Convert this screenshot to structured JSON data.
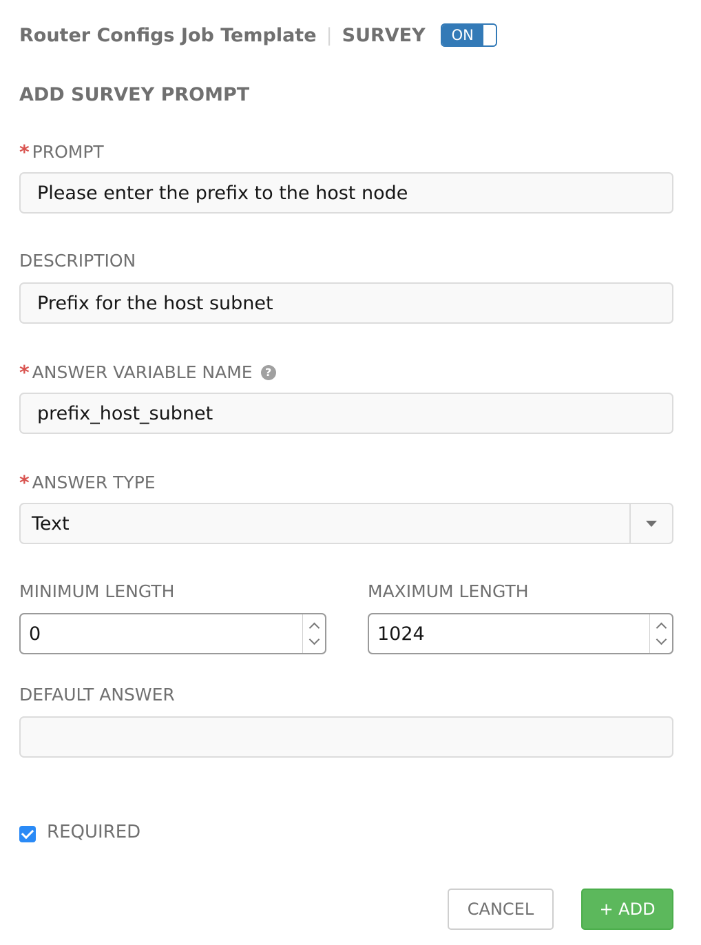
{
  "header": {
    "template_name": "Router Configs Job Template",
    "separator": "|",
    "survey_label": "SURVEY",
    "toggle_label": "ON"
  },
  "section_title": "ADD SURVEY PROMPT",
  "prompt": {
    "label": "PROMPT",
    "required_marker": "*",
    "value": "Please enter the prefix to the host node"
  },
  "description": {
    "label": "DESCRIPTION",
    "value": "Prefix for the host subnet"
  },
  "answer_variable": {
    "label": "ANSWER VARIABLE NAME",
    "required_marker": "*",
    "help_icon": "question-circle-icon",
    "help_glyph": "?",
    "value": "prefix_host_subnet"
  },
  "answer_type": {
    "label": "ANSWER TYPE",
    "required_marker": "*",
    "value": "Text"
  },
  "min_length": {
    "label": "MINIMUM LENGTH",
    "value": "0"
  },
  "max_length": {
    "label": "MAXIMUM LENGTH",
    "value": "1024"
  },
  "default_answer": {
    "label": "DEFAULT ANSWER",
    "value": ""
  },
  "required_checkbox": {
    "label": "REQUIRED",
    "checked": true
  },
  "buttons": {
    "cancel": "CANCEL",
    "add": "+ ADD"
  },
  "colors": {
    "accent_blue": "#337ab7",
    "required_red": "#d9534f",
    "add_green": "#5cb85c",
    "checkbox_blue": "#2a8af6"
  }
}
